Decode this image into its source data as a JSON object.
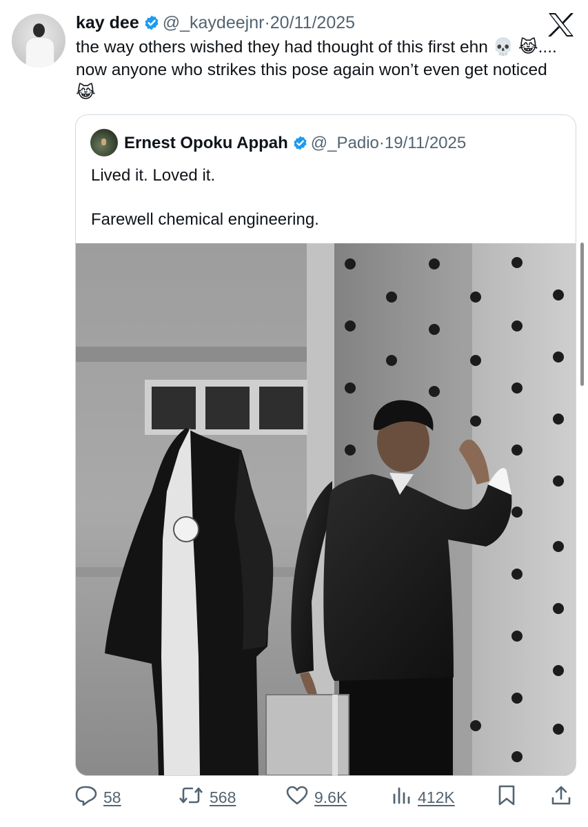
{
  "author": {
    "name": "kay dee",
    "handle": "@_kaydeejnr",
    "separator": "·",
    "date": "20/11/2025"
  },
  "tweet": {
    "text": "the way others wished they had thought of this first ehn 💀 😹.... now anyone who strikes this pose again won’t even get noticed 😹"
  },
  "quoted": {
    "name": "Ernest Opoku Appah",
    "handle": "@_Padio",
    "separator": "·",
    "date": "19/11/2025",
    "line1": "Lived it. Loved it.",
    "line2": "Farewell chemical engineering.",
    "image": "black-and-white graduation photo"
  },
  "metrics": {
    "replies": "58",
    "reposts": "568",
    "likes": "9.6K",
    "views": "412K"
  },
  "icons": [
    "verified-badge-icon",
    "x-logo-icon",
    "reply-icon",
    "repost-icon",
    "like-icon",
    "views-icon",
    "bookmark-icon",
    "share-icon"
  ],
  "colors": {
    "verified": "#1d9bf0",
    "muted": "#536471",
    "border": "#cfd9de"
  }
}
